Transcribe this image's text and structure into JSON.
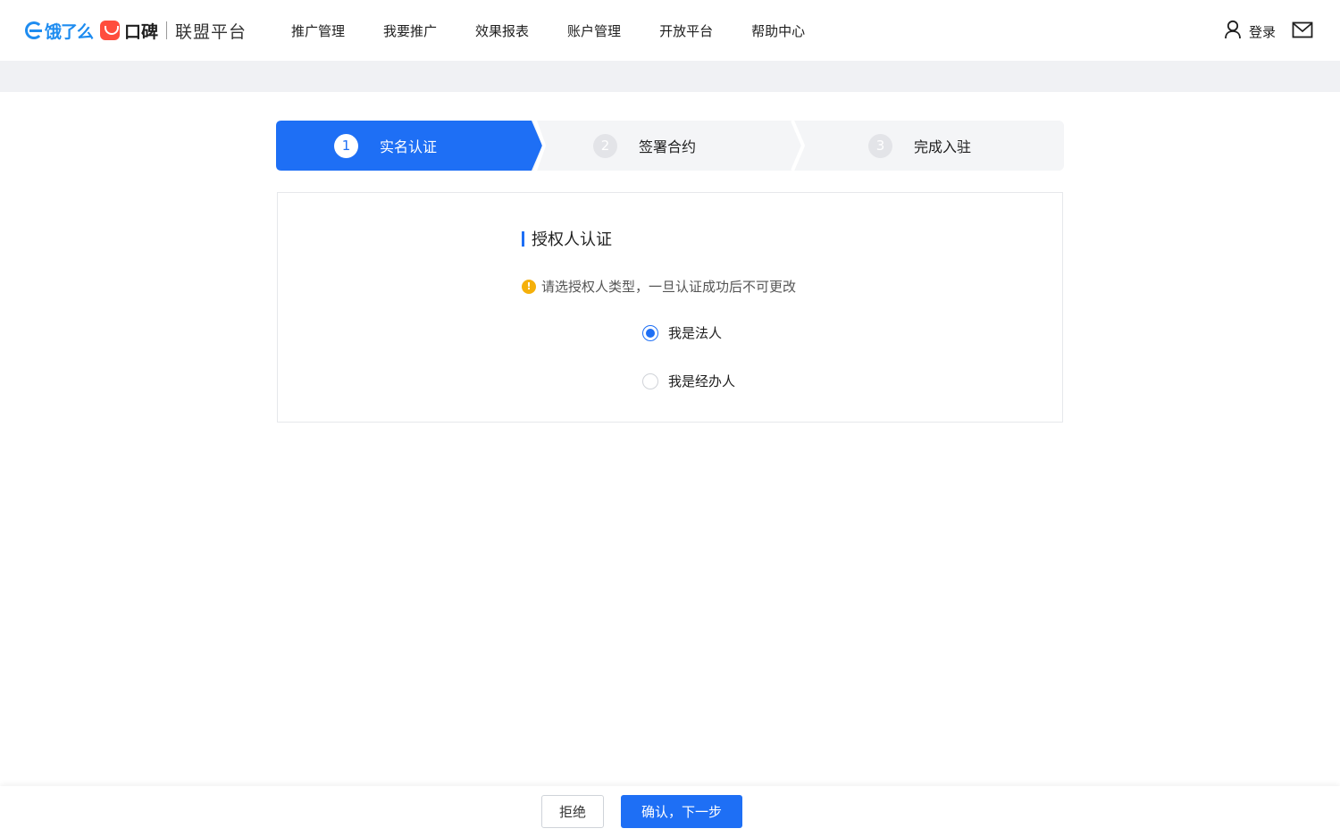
{
  "header": {
    "brand_eleme": "饿了么",
    "brand_koubei": "口碑",
    "brand_platform": "联盟平台",
    "nav": [
      "推广管理",
      "我要推广",
      "效果报表",
      "账户管理",
      "开放平台",
      "帮助中心"
    ],
    "login_label": "登录",
    "icons": {
      "user": "user-icon",
      "mail": "mail-icon"
    }
  },
  "steps": [
    {
      "number": "1",
      "label": "实名认证",
      "state": "active"
    },
    {
      "number": "2",
      "label": "签署合约",
      "state": "todo"
    },
    {
      "number": "3",
      "label": "完成入驻",
      "state": "todo"
    }
  ],
  "form": {
    "title": "授权人认证",
    "notice": "请选授权人类型，一旦认证成功后不可更改",
    "options": [
      {
        "label": "我是法人",
        "checked": true
      },
      {
        "label": "我是经办人",
        "checked": false
      }
    ]
  },
  "footer": {
    "reject_label": "拒绝",
    "confirm_label": "确认，下一步"
  },
  "colors": {
    "primary": "#1e6ff5",
    "warning": "#f5b00a",
    "band": "#f0f1f4"
  }
}
